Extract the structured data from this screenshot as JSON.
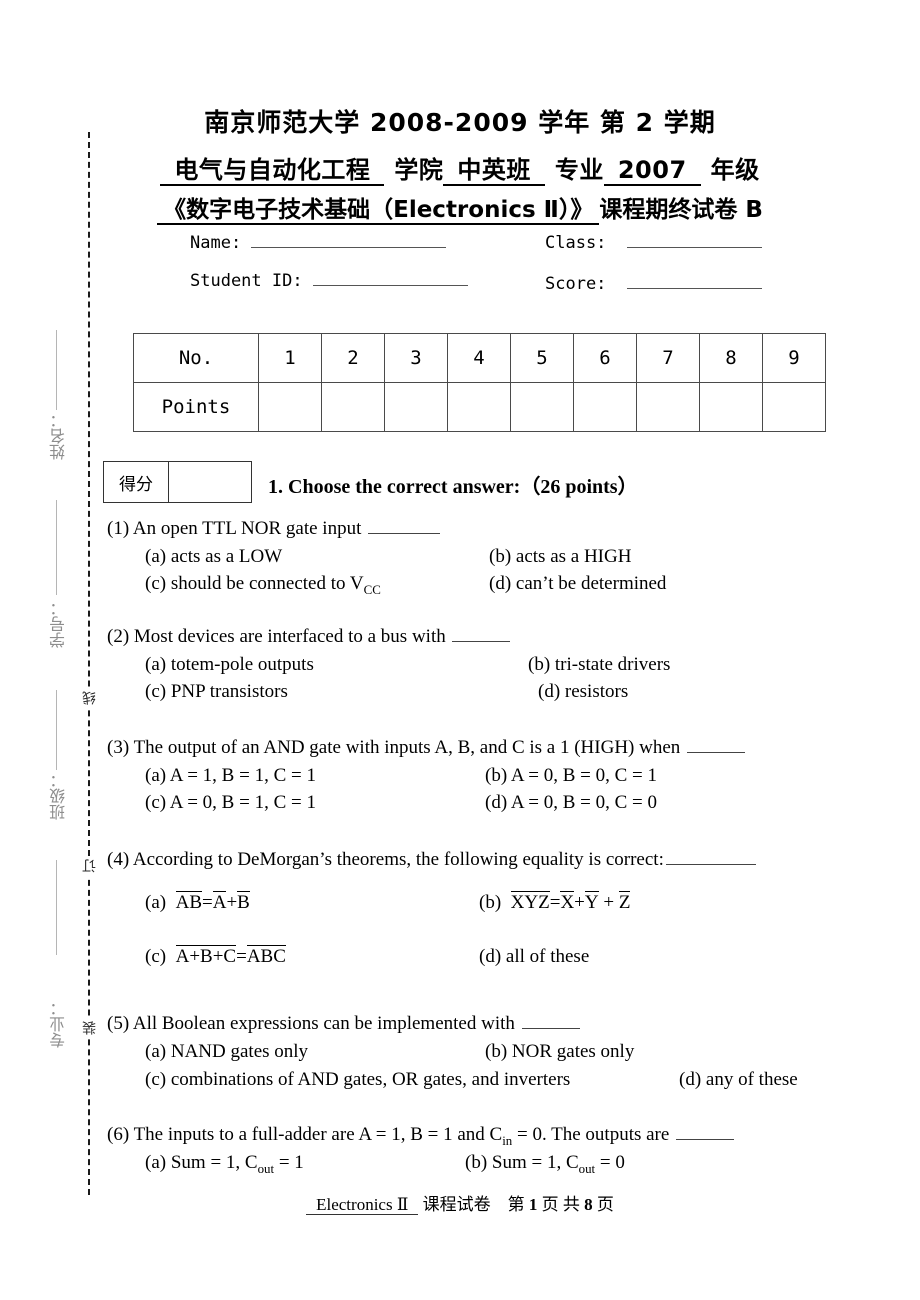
{
  "header": {
    "line1": "南京师范大学 2008-2009 学年  第 2 学期",
    "line2_dept": "电气与自动化工程",
    "line2_dept_suffix": "学院",
    "line2_major": "中英班",
    "line2_major_suffix": "专业",
    "line2_year": "2007",
    "line2_year_suffix": "年级",
    "line3_title": "《数字电子技术基础（Electronics Ⅱ）》",
    "line3_suffix": "课程期终试卷 B"
  },
  "identity": {
    "name_label": "Name:",
    "name_value": "",
    "class_label": "Class:",
    "class_value": "",
    "student_id_label": "Student ID:",
    "student_id_value": "",
    "score_label": "Score:",
    "score_value": ""
  },
  "score_table": {
    "row_headers": [
      "No.",
      "Points"
    ],
    "numbers": [
      "1",
      "2",
      "3",
      "4",
      "5",
      "6",
      "7",
      "8",
      "9"
    ],
    "points": [
      "",
      "",
      "",
      "",
      "",
      "",
      "",
      "",
      ""
    ]
  },
  "defen": {
    "label": "得分",
    "value": ""
  },
  "section": {
    "title": "1. Choose the correct answer:（26 points）"
  },
  "questions": [
    {
      "num": "(1)",
      "stem": "An open TTL NOR gate input",
      "options": [
        {
          "key": "(a)",
          "text": "acts as a LOW"
        },
        {
          "key": "(b)",
          "text": "acts as a HIGH"
        },
        {
          "key": "(c)",
          "text": "should be connected to V",
          "sub": "CC"
        },
        {
          "key": "(d)",
          "text": "can’t be determined"
        }
      ]
    },
    {
      "num": "(2)",
      "stem": "Most devices are interfaced to a bus with",
      "options": [
        {
          "key": "(a)",
          "text": "totem-pole outputs"
        },
        {
          "key": "(b)",
          "text": "tri-state drivers"
        },
        {
          "key": "(c)",
          "text": "PNP transistors"
        },
        {
          "key": "(d)",
          "text": "resistors"
        }
      ]
    },
    {
      "num": "(3)",
      "stem": "The output of an AND gate with inputs A, B, and C is a 1 (HIGH) when",
      "options": [
        {
          "key": "(a)",
          "text": "A = 1, B = 1, C = 1"
        },
        {
          "key": "(b)",
          "text": "A = 0, B = 0, C = 1"
        },
        {
          "key": "(c)",
          "text": "A = 0, B = 1, C = 1"
        },
        {
          "key": "(d)",
          "text": "A = 0, B = 0, C = 0"
        }
      ]
    },
    {
      "num": "(4)",
      "stem": "According to DeMorgan’s theorems, the following equality is correct:",
      "options": [
        {
          "key": "(a)",
          "text": "AB̄ = Ā + B̄ (AB overlined = A-bar + B-bar)"
        },
        {
          "key": "(b)",
          "text": "XYZ overlined = X-bar + Y-bar + Z-bar"
        },
        {
          "key": "(c)",
          "text": "A+B+C overlined = A-bar B-bar C-bar"
        },
        {
          "key": "(d)",
          "text": "all of these"
        }
      ]
    },
    {
      "num": "(5)",
      "stem": "All Boolean expressions can be implemented with",
      "options": [
        {
          "key": "(a)",
          "text": "NAND gates only"
        },
        {
          "key": "(b)",
          "text": "NOR gates only"
        },
        {
          "key": "(c)",
          "text": "combinations of AND gates, OR gates, and inverters"
        },
        {
          "key": "(d)",
          "text": "any of these"
        }
      ]
    },
    {
      "num": "(6)",
      "stem": "The inputs to a full-adder are A = 1, B = 1 and C",
      "stem_sub": "in",
      "stem_tail": "= 0. The outputs are",
      "options": [
        {
          "key": "(a)",
          "text": "Sum = 1,  C",
          "sub": "out",
          "tail": "= 1"
        },
        {
          "key": "(b)",
          "text": "Sum = 1,  C",
          "sub": "out",
          "tail": "= 0"
        }
      ]
    }
  ],
  "q4_formulas": {
    "a_key": "(a)",
    "a_lhs_over": "AB",
    "a_eq": "=",
    "a_r1": "A",
    "a_plus": "+",
    "a_r2": "B",
    "b_key": "(b)",
    "b_lhs_over": "XYZ",
    "b_eq": "=",
    "b_r1": "X",
    "b_plus1": "+",
    "b_r2": "Y",
    "b_plus2": "+",
    "b_r3": "Z",
    "c_key": "(c)",
    "c_lhs_over": "A+B+C",
    "c_eq": "=",
    "c_r1": "A",
    "c_r2": "B",
    "c_r3": "C",
    "d_key": "(d)",
    "d_text": "all of these"
  },
  "seal": {
    "labels": [
      "姓名：",
      "学号：",
      "班级：",
      "专业："
    ],
    "marks": [
      "线",
      "订",
      "装"
    ]
  },
  "footer": {
    "course": "Electronics  Ⅱ",
    "course_suffix": "课程试卷",
    "page_prefix": "第",
    "page_num": "1",
    "page_mid": "页 共",
    "page_total": "8",
    "page_suffix": "页"
  }
}
